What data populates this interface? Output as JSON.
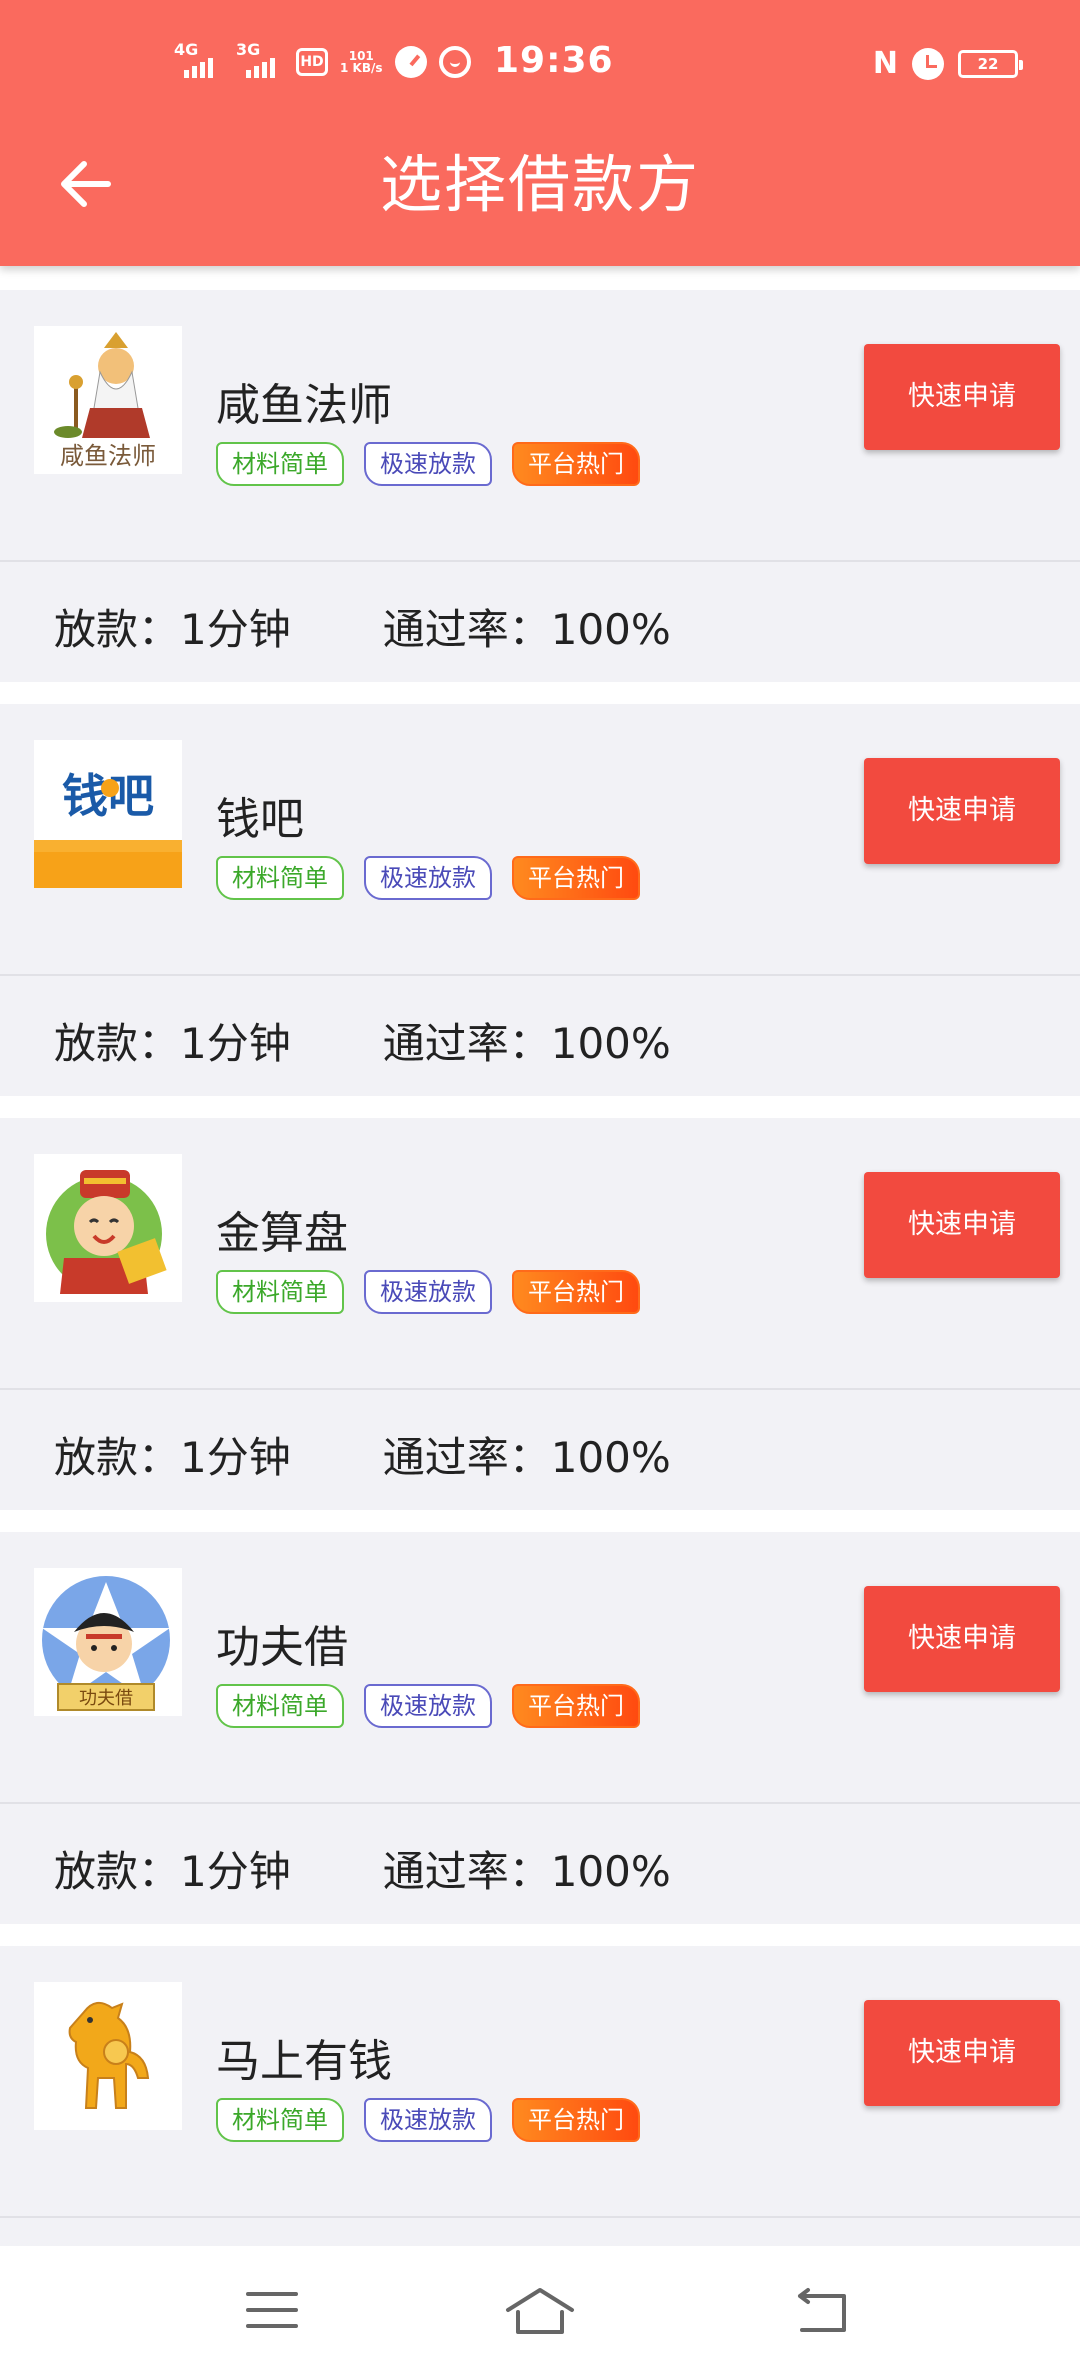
{
  "status_bar": {
    "network1": "4G",
    "network2": "3G",
    "hd": "HD",
    "speed_value": "101",
    "speed_unit": "KB/s",
    "speed_sub": "1",
    "time": "19:36",
    "nfc": "N",
    "battery": "22"
  },
  "header": {
    "title": "选择借款方",
    "back_icon": "arrow-left-icon"
  },
  "lenders": [
    {
      "name": "咸鱼法师",
      "logo_text": "咸鱼法师",
      "tags": [
        "材料简单",
        "极速放款",
        "平台热门"
      ],
      "button": "快速申请",
      "loan_label": "放款：1分钟",
      "pass_label": "通过率：100%"
    },
    {
      "name": "钱吧",
      "logo_text": "钱吧",
      "tags": [
        "材料简单",
        "极速放款",
        "平台热门"
      ],
      "button": "快速申请",
      "loan_label": "放款：1分钟",
      "pass_label": "通过率：100%"
    },
    {
      "name": "金算盘",
      "logo_text": "",
      "tags": [
        "材料简单",
        "极速放款",
        "平台热门"
      ],
      "button": "快速申请",
      "loan_label": "放款：1分钟",
      "pass_label": "通过率：100%"
    },
    {
      "name": "功夫借",
      "logo_text": "功夫借",
      "tags": [
        "材料简单",
        "极速放款",
        "平台热门"
      ],
      "button": "快速申请",
      "loan_label": "放款：1分钟",
      "pass_label": "通过率：100%"
    },
    {
      "name": "马上有钱",
      "logo_text": "",
      "tags": [
        "材料简单",
        "极速放款",
        "平台热门"
      ],
      "button": "快速申请",
      "loan_label": "",
      "pass_label": ""
    }
  ],
  "nav": {
    "menu_icon": "menu-icon",
    "home_icon": "home-icon",
    "back_icon": "back-icon"
  },
  "colors": {
    "header": "#fa6a5e",
    "apply_button": "#f24a3f",
    "tag_green": "#62c44a",
    "tag_blue": "#6a6ad0",
    "tag_hot": "#ff5a14"
  }
}
